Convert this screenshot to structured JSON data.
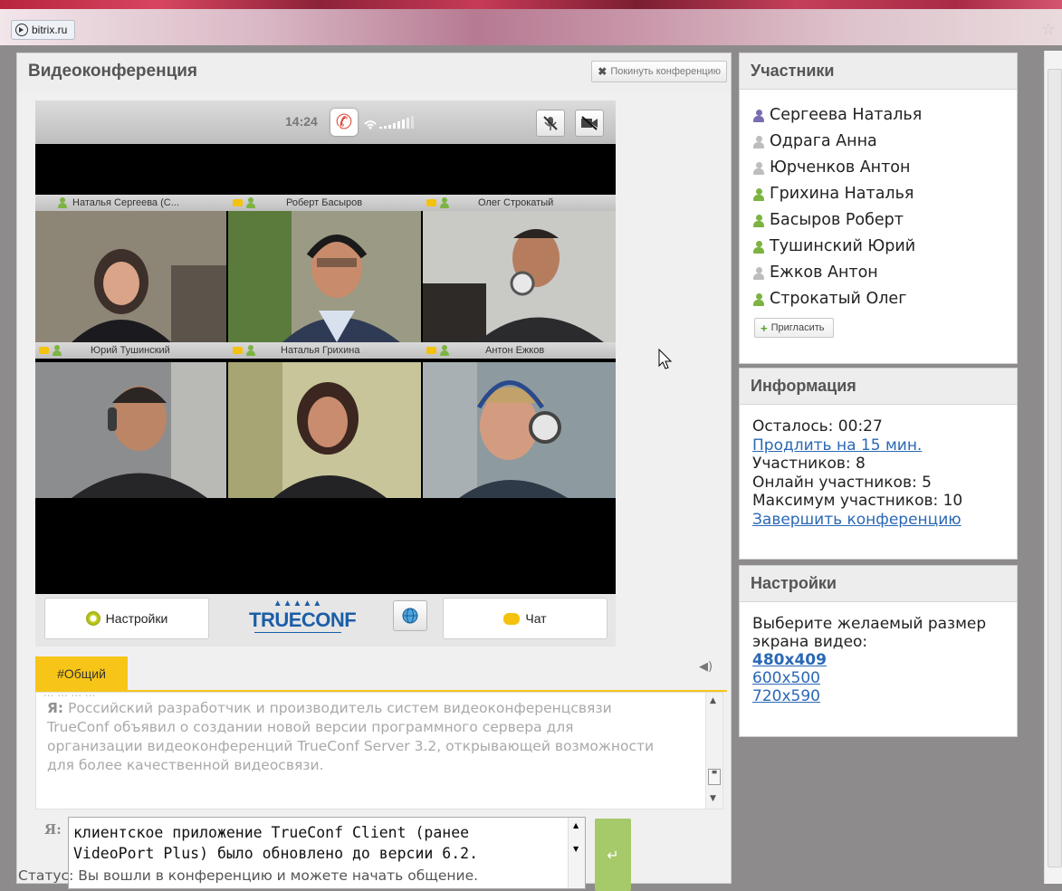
{
  "browser": {
    "url": "bitrix.ru"
  },
  "main": {
    "title": "Видеоконференция",
    "leave_label": "Покинуть конференцию",
    "video": {
      "time": "14:24",
      "top_names": [
        "Наталья Сергеева (С...",
        "Роберт Басыров",
        "Олег Строкатый"
      ],
      "bottom_names": [
        "Юрий Тушинский",
        "Наталья Грихина",
        "Антон Ежков"
      ],
      "settings_label": "Настройки",
      "logo_text": "TRUECONF",
      "chat_label": "Чат"
    },
    "chat_tab": "#Общий",
    "chat_log": {
      "cut_line": "... ... ... ...",
      "speaker": "Я:",
      "message": "Российский разработчик и производитель систем видеоконференцсвязи TrueConf объявил о создании новой версии программного сервера для организации видеоконференций TrueConf Server 3.2, открывающей возможности для более качественной видеосвязи."
    },
    "composer": {
      "speaker": "Я:",
      "text": "клиентское приложение TrueConf Client (ранее VideoPort Plus) было обновлено до версии 6.2."
    },
    "status": "Статус: Вы вошли в конференцию и можете начать общение."
  },
  "participants": {
    "title": "Участники",
    "items": [
      {
        "name": "Сергеева Наталья",
        "state": "admin"
      },
      {
        "name": "Одрага Анна",
        "state": "offline"
      },
      {
        "name": "Юрченков Антон",
        "state": "offline"
      },
      {
        "name": "Грихина Наталья",
        "state": "online"
      },
      {
        "name": "Басыров Роберт",
        "state": "online"
      },
      {
        "name": "Тушинский Юрий",
        "state": "online"
      },
      {
        "name": "Ежков Антон",
        "state": "offline"
      },
      {
        "name": "Строкатый Олег",
        "state": "online"
      }
    ],
    "invite_label": "Пригласить"
  },
  "info": {
    "title": "Информация",
    "remaining": "Осталось: 00:27",
    "extend_link": "Продлить на 15 мин.",
    "participants_count": "Участников: 8",
    "online_count": "Онлайн участников: 5",
    "max_count": "Максимум участников: 10",
    "end_link": "Завершить конференцию"
  },
  "settings": {
    "title": "Настройки",
    "prompt": "Выберите желаемый размер экрана видео:",
    "sizes": [
      "480x409",
      "600x500",
      "720x590"
    ]
  },
  "colors": {
    "accent_yellow": "#f7c517",
    "online_green": "#7cb342",
    "link_blue": "#2a68b5",
    "send_green": "#a6c96a"
  }
}
